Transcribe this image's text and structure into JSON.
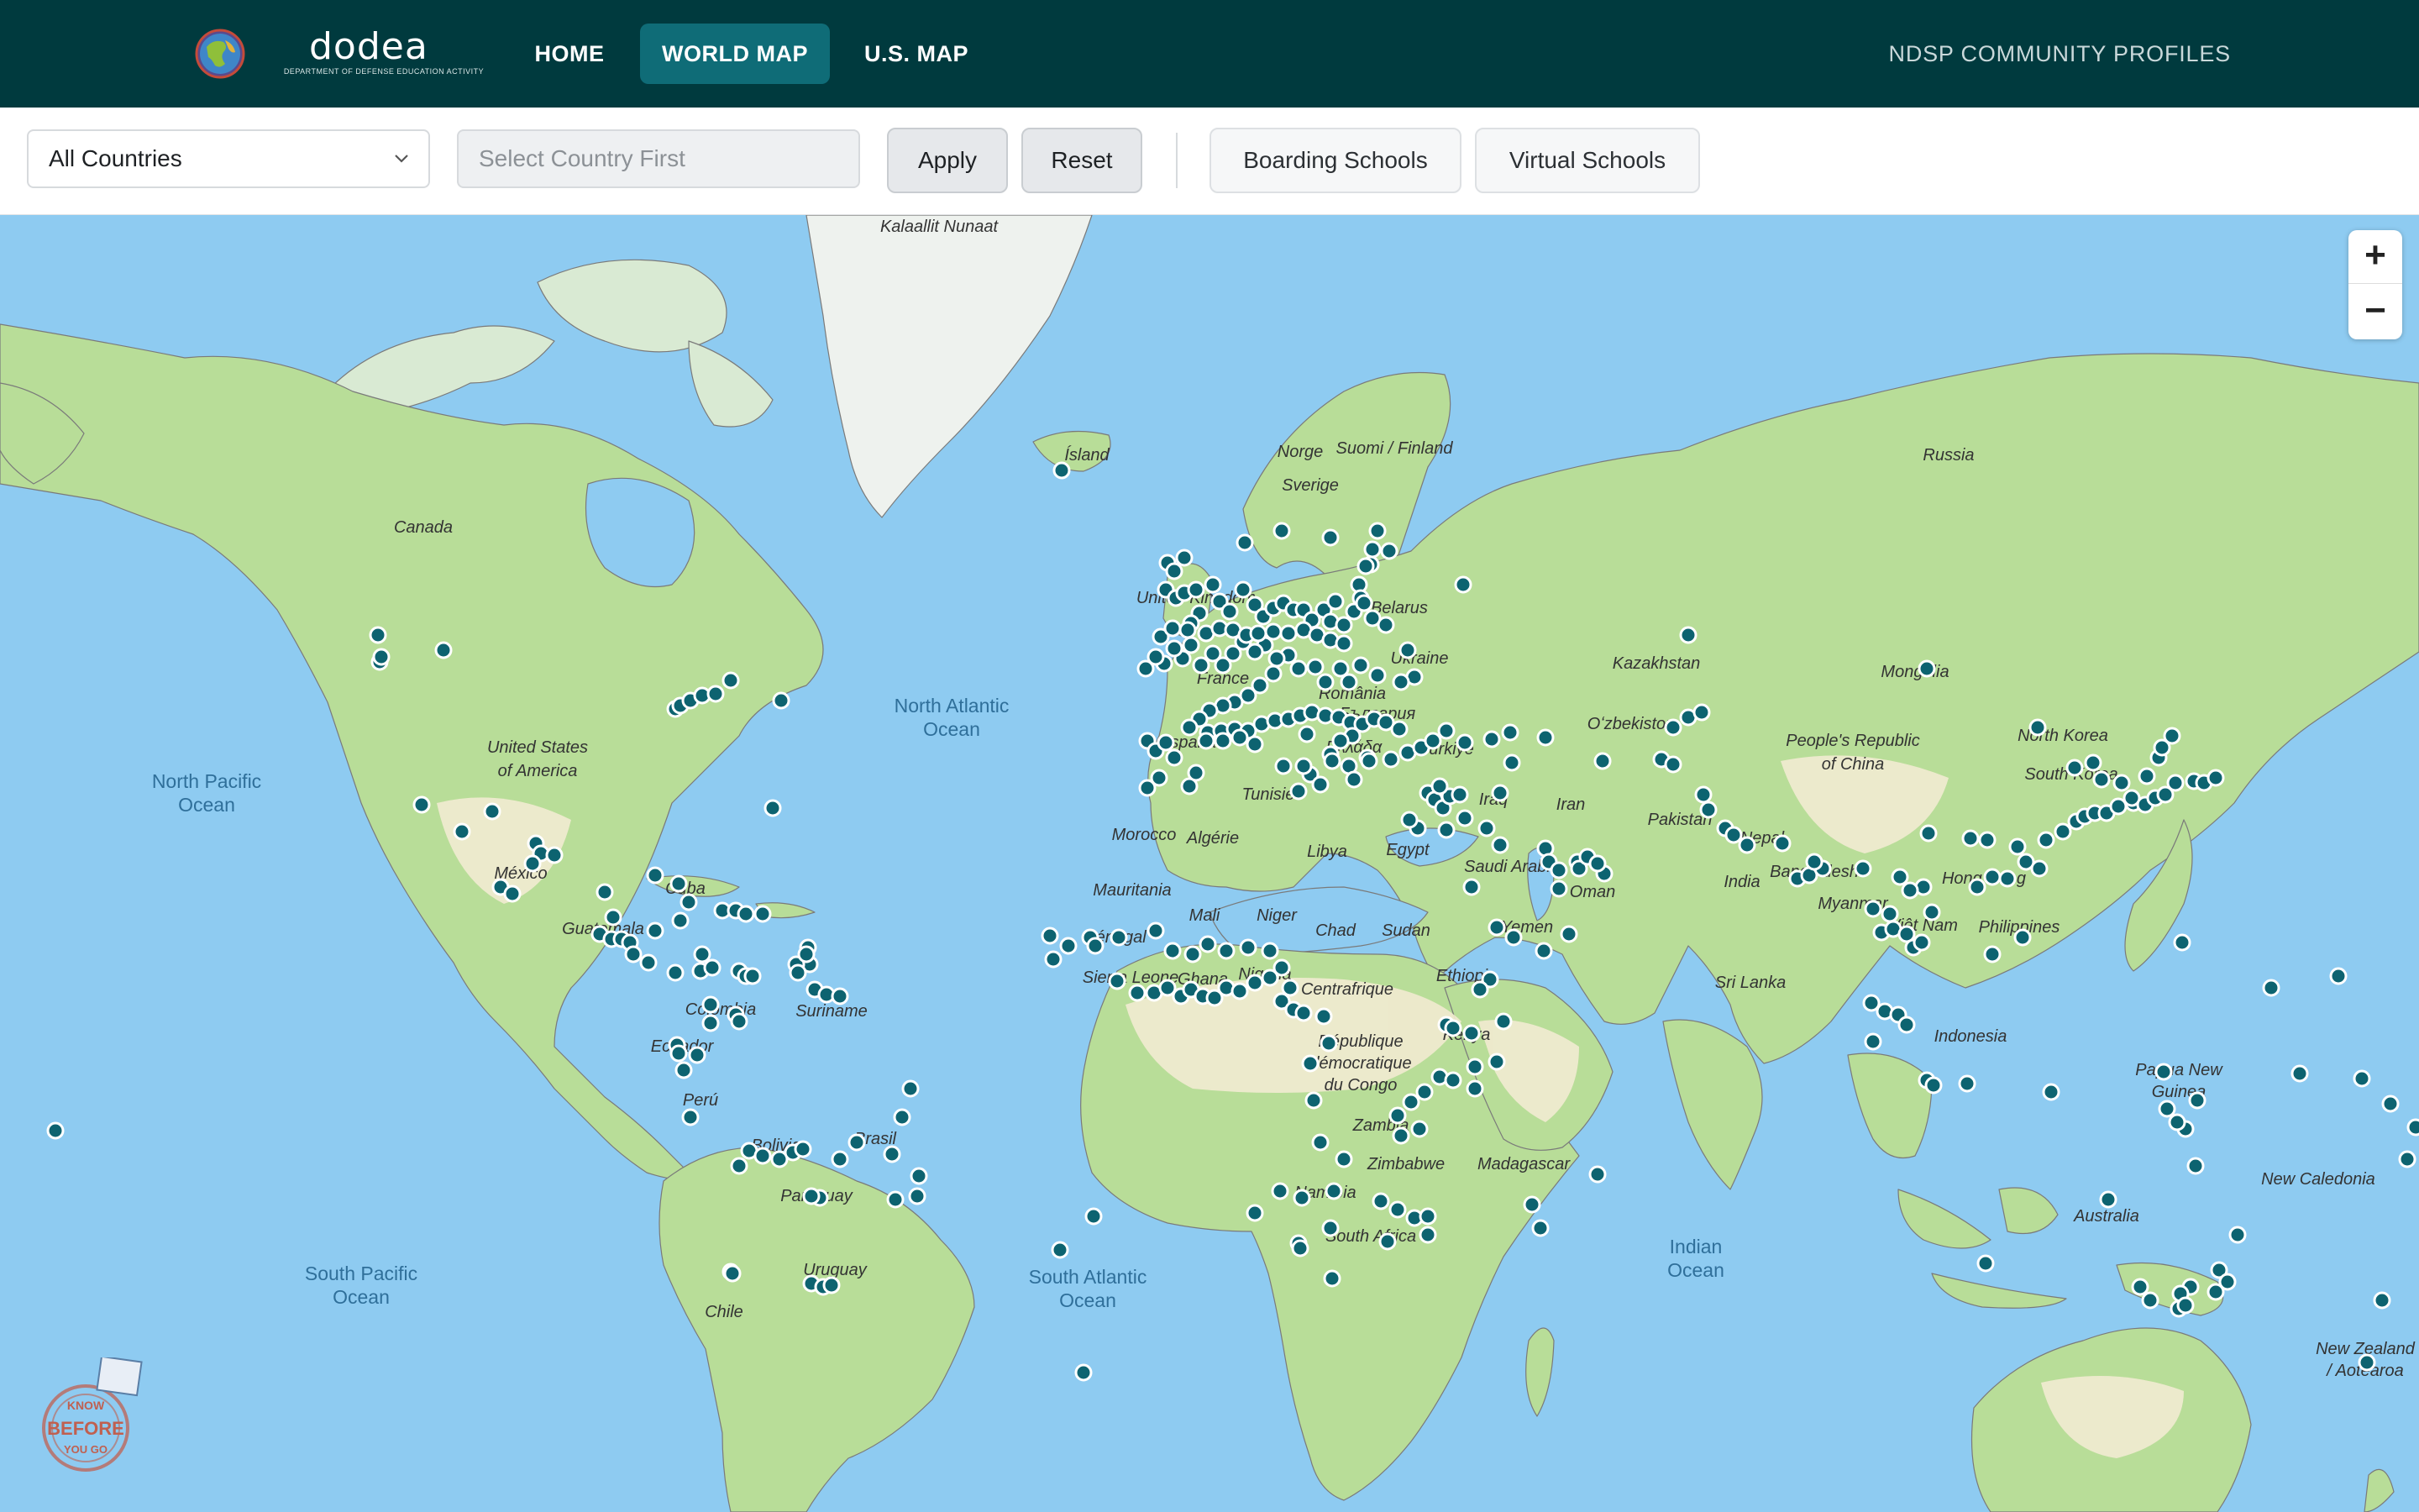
{
  "header": {
    "logo_wordmark": "dodea",
    "logo_subtitle": "DEPARTMENT OF DEFENSE EDUCATION ACTIVITY",
    "nav": {
      "home": "HOME",
      "world_map": "WORLD MAP",
      "us_map": "U.S. MAP"
    },
    "ndsp_link": "NDSP COMMUNITY PROFILES"
  },
  "filters": {
    "country_select_value": "All Countries",
    "region_placeholder": "Select Country First",
    "apply_label": "Apply",
    "reset_label": "Reset",
    "boarding_label": "Boarding Schools",
    "virtual_label": "Virtual Schools"
  },
  "map": {
    "zoom_in": "+",
    "zoom_out": "−",
    "marker_color": "#0d6370",
    "marker_count": 361,
    "badge_text": [
      "KNOW",
      "BEFORE",
      "YOU GO"
    ],
    "ocean_labels": [
      "North Atlantic",
      "Ocean",
      "North Pacific",
      "Ocean",
      "South Pacific",
      "Ocean",
      "South Atlantic",
      "Ocean",
      "Indian",
      "Ocean"
    ],
    "country_labels": {
      "greenland": "Kalaallit Nunaat",
      "iceland": "Ísland",
      "canada": "Canada",
      "usa_1": "United States",
      "usa_2": "of America",
      "mexico": "México",
      "cuba": "Cuba",
      "guatemala": "Guatemala",
      "colombia": "Colombia",
      "suriname": "Suriname",
      "ecuador": "Ecuador",
      "peru": "Perú",
      "bolivia": "Bolivia",
      "brasil": "Brasil",
      "paraguay": "Paraguay",
      "uruguay": "Uruguay",
      "chile": "Chile",
      "norge": "Norge",
      "suomi": "Suomi / Finland",
      "sverige": "Sverige",
      "uk": "United Kingdom",
      "france": "France",
      "espana": "España",
      "belarus": "Belarus",
      "ukraine": "Ukraine",
      "romania": "România",
      "bulgaria": "България",
      "greece": "Ελλάδα",
      "turkiye": "Türkiye",
      "russia": "Russia",
      "kazakhstan": "Kazakhstan",
      "mongolia": "Mongolia",
      "uzbekistan": "Oʻzbekiston",
      "china_1": "People's Republic",
      "china_2": "of China",
      "north_korea": "North Korea",
      "south_korea": "South Korea",
      "iraq": "Iraq",
      "iran": "Iran",
      "pakistan": "Pakistan",
      "nepal": "Nepal",
      "india": "India",
      "bangladesh": "Bangladesh",
      "myanmar": "Myanmar",
      "hong_kong": "Hong Kong",
      "viet_nam": "Việt Nam",
      "philippines": "Philippines",
      "sri_lanka": "Sri Lanka",
      "oman": "Oman",
      "saudi_arabia": "Saudi Arabia",
      "yemen": "Yemen",
      "morocco": "Morocco",
      "algerie": "Algérie",
      "tunisie": "Tunisie",
      "libya": "Libya",
      "egypt": "Egypt",
      "mauritania": "Mauritania",
      "mali": "Mali",
      "niger": "Niger",
      "chad": "Chad",
      "sudan": "Sudan",
      "senegal": "Sénégal",
      "sierra_leone": "Sierra Leone",
      "ghana": "Ghana",
      "nigeria": "Nigeria",
      "ethiopia": "Ethiopia",
      "centrafrique": "Centrafrique",
      "rdc_1": "République",
      "rdc_2": "démocratique",
      "rdc_3": "du Congo",
      "kenya": "Kenya",
      "zambia": "Zambia",
      "zimbabwe": "Zimbabwe",
      "namibia": "Namibia",
      "south_africa": "South Africa",
      "madagascar": "Madagascar",
      "indonesia": "Indonesia",
      "png_1": "Papua New",
      "png_2": "Guinea",
      "australia": "Australia",
      "new_caledonia": "New Caledonia",
      "nz_1": "New Zealand",
      "nz_2": "/ Aotearoa"
    }
  }
}
